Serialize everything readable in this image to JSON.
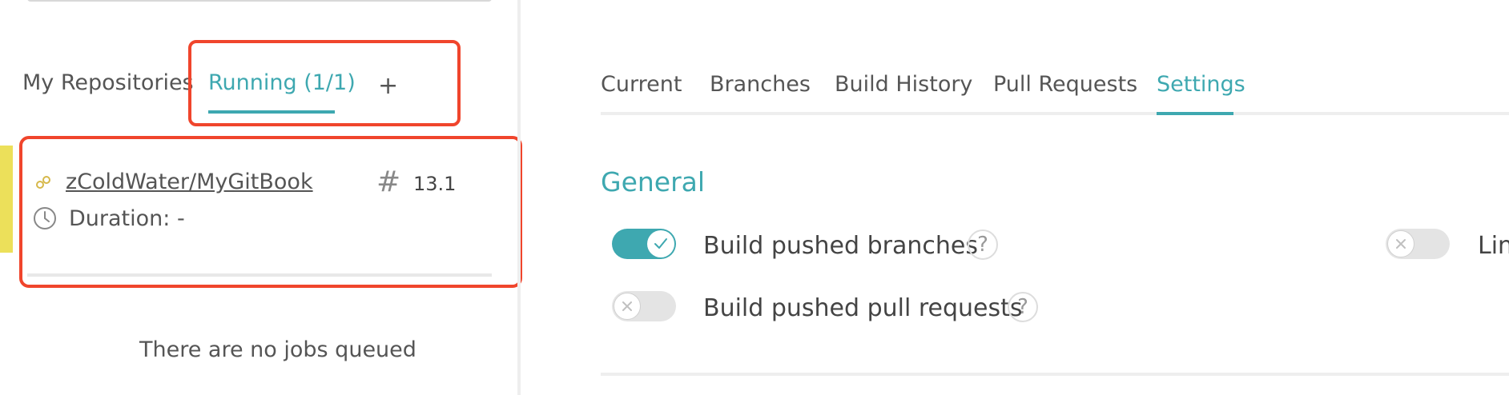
{
  "left_panel": {
    "tabs": [
      {
        "label": "My Repositories"
      },
      {
        "label": "Running (1/1)"
      },
      {
        "label": "+"
      }
    ],
    "job": {
      "repo": "zColdWater/MyGitBook",
      "build_number": "13.1",
      "duration_label": "Duration: -"
    },
    "queue_message": "There are no jobs queued"
  },
  "right_panel": {
    "tabs": [
      {
        "label": "Current"
      },
      {
        "label": "Branches"
      },
      {
        "label": "Build History"
      },
      {
        "label": "Pull Requests"
      },
      {
        "label": "Settings"
      }
    ],
    "active_tab": "Settings",
    "section_title": "General",
    "options": [
      {
        "label": "Build pushed branches",
        "enabled": true
      },
      {
        "label": "Build pushed pull requests",
        "enabled": false
      },
      {
        "label": "Lin",
        "enabled": false
      }
    ]
  },
  "colors": {
    "accent": "#3ea8b0",
    "highlight": "#f0452c",
    "running": "#ece05a"
  },
  "icons": [
    "repo-status-icon",
    "hash-icon",
    "clock-icon",
    "check-icon",
    "x-icon",
    "help-icon"
  ]
}
